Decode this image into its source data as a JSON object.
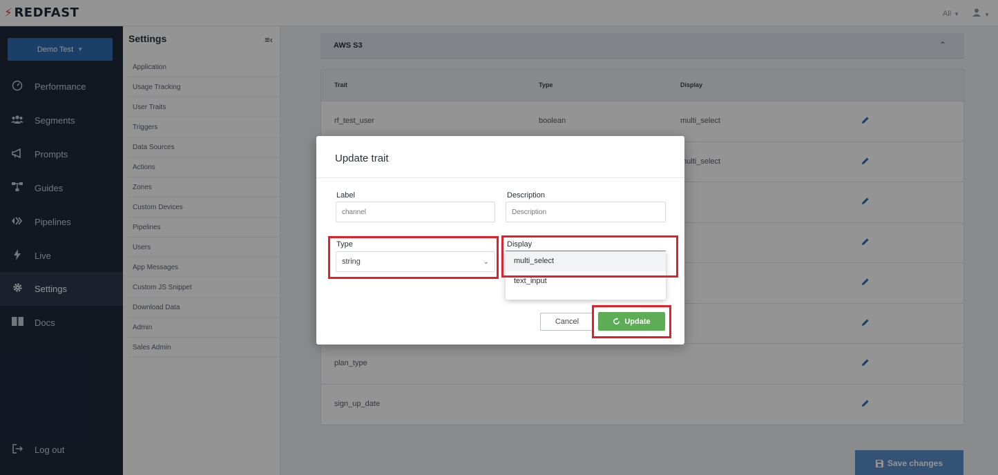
{
  "app": {
    "logo_text": "REDFAST",
    "filter_label": "All"
  },
  "nav": {
    "workspace_button": "Demo Test",
    "items": [
      {
        "label": "Performance",
        "icon": "gauge-icon"
      },
      {
        "label": "Segments",
        "icon": "users-icon"
      },
      {
        "label": "Prompts",
        "icon": "megaphone-icon"
      },
      {
        "label": "Guides",
        "icon": "sitemap-icon"
      },
      {
        "label": "Pipelines",
        "icon": "pipeline-icon"
      },
      {
        "label": "Live",
        "icon": "bolt-icon"
      },
      {
        "label": "Settings",
        "icon": "gear-icon",
        "active": true
      },
      {
        "label": "Docs",
        "icon": "book-icon"
      }
    ],
    "logout_label": "Log out"
  },
  "settings": {
    "title": "Settings",
    "items": [
      "Application",
      "Usage Tracking",
      "User Traits",
      "Triggers",
      "Data Sources",
      "Actions",
      "Zones",
      "Custom Devices",
      "Pipelines",
      "Users",
      "App Messages",
      "Custom JS Snippet",
      "Download Data",
      "Admin",
      "Sales Admin"
    ]
  },
  "main": {
    "section_title": "AWS S3",
    "table": {
      "headers": [
        "Trait",
        "Type",
        "Display"
      ],
      "rows": [
        {
          "trait": "rf_test_user",
          "type": "boolean",
          "display": "multi_select"
        },
        {
          "trait": "",
          "type": "",
          "display": "multi_select"
        },
        {
          "trait": "",
          "type": "",
          "display": ""
        },
        {
          "trait": "",
          "type": "",
          "display": ""
        },
        {
          "trait": "",
          "type": "",
          "display": ""
        },
        {
          "trait": "",
          "type": "",
          "display": ""
        },
        {
          "trait": "plan_type",
          "type": "",
          "display": ""
        },
        {
          "trait": "sign_up_date",
          "type": "",
          "display": ""
        }
      ]
    },
    "save_label": "Save changes"
  },
  "modal": {
    "title": "Update trait",
    "label_field": {
      "label": "Label",
      "placeholder": "channel"
    },
    "description_field": {
      "label": "Description",
      "placeholder": "Description"
    },
    "type_field": {
      "label": "Type",
      "value": "string"
    },
    "display_field": {
      "label": "Display",
      "options": [
        "multi_select",
        "text_input"
      ]
    },
    "cancel_label": "Cancel",
    "update_label": "Update"
  },
  "colors": {
    "nav_bg": "#1e2a3c",
    "primary": "#2e6eb5",
    "update_green": "#5cad55",
    "highlight_red": "#e0202a"
  }
}
